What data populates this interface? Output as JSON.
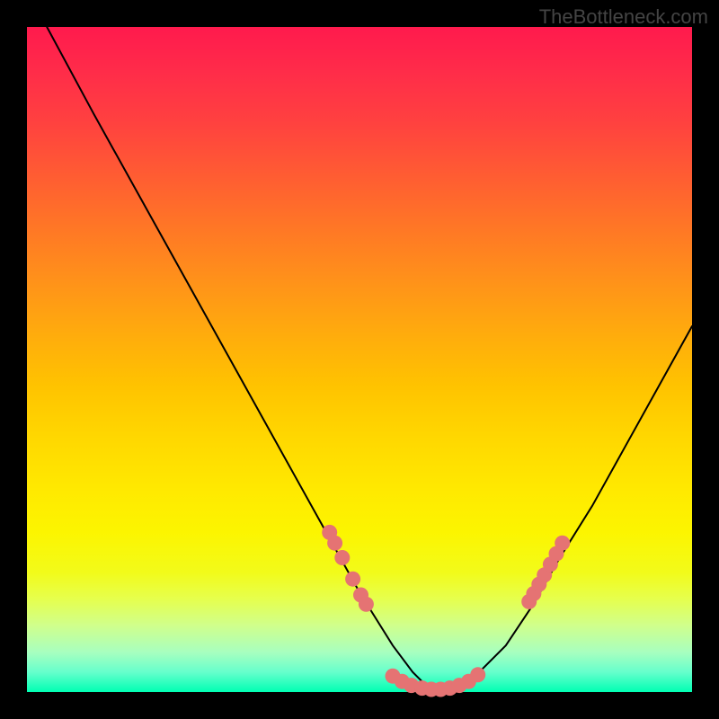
{
  "watermark": "TheBottleneck.com",
  "chart_data": {
    "type": "line",
    "title": "",
    "xlabel": "",
    "ylabel": "",
    "xlim": [
      0,
      100
    ],
    "ylim": [
      0,
      100
    ],
    "series": [
      {
        "name": "curve",
        "x": [
          3,
          10,
          20,
          30,
          40,
          45,
          50,
          55,
          58,
          60,
          62,
          65,
          68,
          72,
          76,
          80,
          85,
          90,
          95,
          100
        ],
        "y": [
          100,
          87,
          69,
          51,
          33,
          24,
          15,
          7,
          3,
          1,
          0.5,
          1,
          3,
          7,
          13,
          20,
          28,
          37,
          46,
          55
        ]
      }
    ],
    "dot_clusters": [
      {
        "name": "left-cluster",
        "color": "#e57373",
        "points": [
          [
            45.5,
            24.0
          ],
          [
            46.3,
            22.4
          ],
          [
            47.4,
            20.2
          ],
          [
            49.0,
            17.0
          ],
          [
            50.2,
            14.6
          ],
          [
            51.0,
            13.2
          ]
        ]
      },
      {
        "name": "bottom-cluster",
        "color": "#e57373",
        "points": [
          [
            55.0,
            2.4
          ],
          [
            56.4,
            1.6
          ],
          [
            57.8,
            1.0
          ],
          [
            59.4,
            0.6
          ],
          [
            60.8,
            0.4
          ],
          [
            62.2,
            0.4
          ],
          [
            63.6,
            0.6
          ],
          [
            65.0,
            1.0
          ],
          [
            66.4,
            1.6
          ],
          [
            67.8,
            2.6
          ]
        ]
      },
      {
        "name": "right-cluster",
        "color": "#e57373",
        "points": [
          [
            75.5,
            13.6
          ],
          [
            76.2,
            14.8
          ],
          [
            77.0,
            16.2
          ],
          [
            77.8,
            17.6
          ],
          [
            78.7,
            19.2
          ],
          [
            79.6,
            20.8
          ],
          [
            80.5,
            22.4
          ]
        ]
      }
    ],
    "gradient_stops": [
      {
        "pos": 0,
        "color": "#ff1a4d"
      },
      {
        "pos": 50,
        "color": "#ffcc00"
      },
      {
        "pos": 85,
        "color": "#f0ff33"
      },
      {
        "pos": 100,
        "color": "#00ffb3"
      }
    ]
  }
}
